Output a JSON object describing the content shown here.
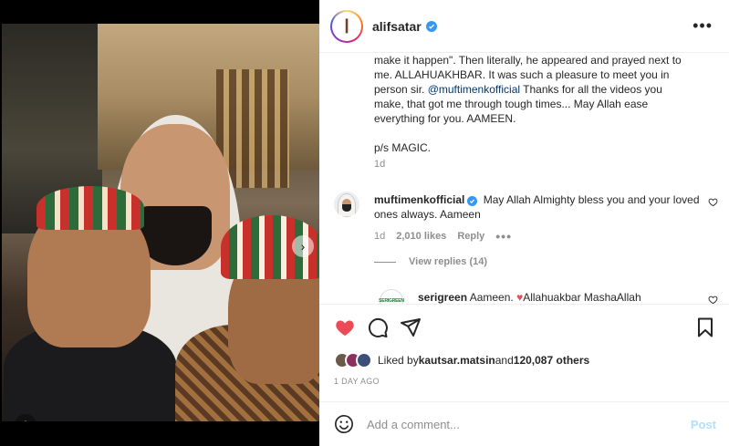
{
  "post": {
    "username": "alifsatar",
    "more_label": "•••",
    "caption_lines": [
      "make it happen\". Then literally, he appeared and prayed next to",
      "me. ALLAHUAKHBAR. It was such a pleasure to meet you in",
      "person sir. ",
      "@muftimenkofficial",
      " Thanks for all the videos you",
      "make, that got me through tough times... May Allah ease",
      "everything for you. AAMEEN."
    ],
    "caption_ps": "p/s MAGIC.",
    "caption_time": "1d",
    "avatar_glyph": "ا"
  },
  "comments": {
    "reply": {
      "username": "muftimenkofficial",
      "text": "May Allah Almighty bless you and your loved ones always. Aameen",
      "time": "1d",
      "likes": "2,010 likes",
      "reply_label": "Reply",
      "options": "•••"
    },
    "view_replies": "View replies (14)",
    "second": {
      "username": "serigreen",
      "text_before": "Aameen. ",
      "heart": "♥",
      "text_after": "Allahuakbar MashaAllah",
      "avatar_logo": "SERIGREEN"
    }
  },
  "engagement": {
    "liked_by_prefix": "Liked by ",
    "liked_by_user": "kautsar.matsin",
    "liked_by_middle": " and ",
    "liked_by_others": "120,087 others",
    "date": "1 DAY AGO"
  },
  "add_comment": {
    "placeholder": "Add a comment...",
    "post_label": "Post"
  },
  "colors": {
    "like_red": "#ed4956",
    "link_blue": "#00376b",
    "verified_blue": "#3897f0",
    "post_disabled": "#b2dffc"
  }
}
